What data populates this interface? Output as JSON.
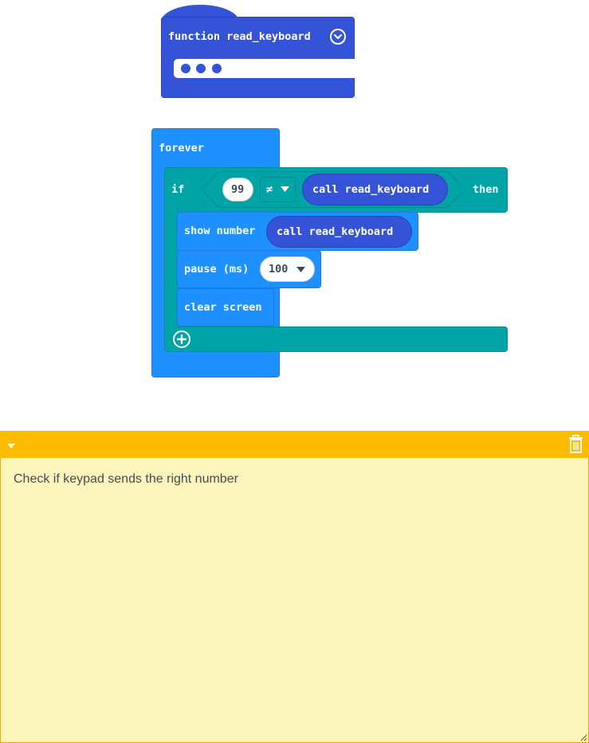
{
  "function_block": {
    "label": "function read_keyboard",
    "params_icon": "ellipsis-dots-icon",
    "collapse_icon": "chevron-down-circle-icon"
  },
  "forever_block": {
    "label": "forever",
    "if_block": {
      "if_label": "if",
      "left_value": "99",
      "operator": "≠",
      "right_call": "call read_keyboard",
      "then_label": "then",
      "statements": [
        {
          "label": "show number",
          "arg": "call read_keyboard"
        },
        {
          "label": "pause (ms)",
          "arg": "100"
        },
        {
          "label": "clear screen"
        }
      ],
      "add_icon": "plus-circle-icon"
    }
  },
  "comment": {
    "collapse_icon": "triangle-down-icon",
    "delete_icon": "trash-icon",
    "text": "Check if keypad sends the right number",
    "resize_icon": "resize-handle-icon"
  },
  "colors": {
    "function": "#3553d6",
    "loop": "#1e90ff",
    "logic": "#00a4a6",
    "comment_header": "#ffbb00",
    "comment_body": "#fbf5bc"
  }
}
